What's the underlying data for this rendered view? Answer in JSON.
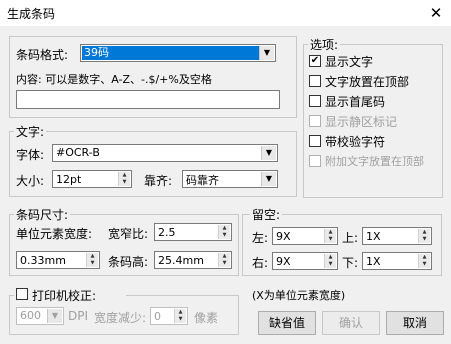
{
  "window": {
    "title": "生成条码",
    "close_glyph": "✕"
  },
  "barcode": {
    "format_label": "条码格式:",
    "format_value": "39码",
    "content_label": "内容: 可以是数字、A-Z、-.$/+%及空格",
    "content_value": ""
  },
  "text_group": {
    "legend": "文字:",
    "font_label": "字体:",
    "font_value": "#OCR-B",
    "size_label": "大小:",
    "size_value": "12pt",
    "align_label": "靠齐:",
    "align_value": "码靠齐"
  },
  "size_group": {
    "legend": "条码尺寸:",
    "unit_width_label": "单位元素宽度:",
    "ratio_label": "宽窄比:",
    "ratio_value": "2.5",
    "unit_value": "0.33mm",
    "height_label": "条码高:",
    "height_value": "25.4mm"
  },
  "margin_group": {
    "legend": "留空:",
    "left_label": "左:",
    "left_value": "9X",
    "top_label": "上:",
    "top_value": "1X",
    "right_label": "右:",
    "right_value": "9X",
    "bottom_label": "下:",
    "bottom_value": "1X"
  },
  "options": {
    "legend": "选项:",
    "items": [
      {
        "label": "显示文字",
        "checked": true,
        "disabled": false
      },
      {
        "label": "文字放置在顶部",
        "checked": false,
        "disabled": false
      },
      {
        "label": "显示首尾码",
        "checked": false,
        "disabled": false
      },
      {
        "label": "显示静区标记",
        "checked": false,
        "disabled": true
      },
      {
        "label": "带校验字符",
        "checked": false,
        "disabled": false
      },
      {
        "label": "附加文字放置在顶部",
        "checked": false,
        "disabled": true
      }
    ]
  },
  "printer_group": {
    "legend": "打印机校正:",
    "dpi_value": "600",
    "dpi_label": "DPI",
    "reduce_label": "宽度减少:",
    "reduce_value": "0",
    "unit_label": "像素"
  },
  "note": "(X为单位元素宽度)",
  "buttons": {
    "default": "缺省值",
    "ok": "确认",
    "cancel": "取消"
  },
  "check_glyph": "✔"
}
